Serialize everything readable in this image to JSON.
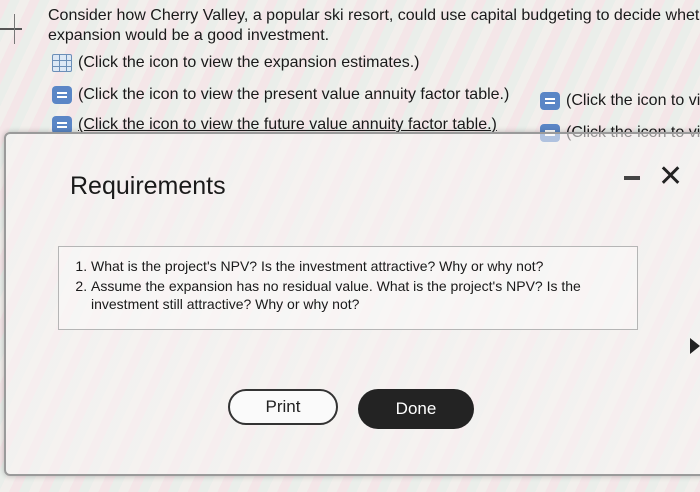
{
  "question": {
    "line1": "Consider how Cherry Valley, a popular ski resort, could use capital budgeting to decide whethe",
    "line2": "expansion would be a good investment."
  },
  "links": {
    "expansion": "(Click the icon to view the expansion estimates.)",
    "pv_annuity": "(Click the icon to view the present value annuity factor table.)",
    "fv_annuity": "(Click the icon to view the future value annuity factor table.)",
    "right_1": "(Click the icon to vie",
    "right_2": "(Click the icon to vie"
  },
  "dialog": {
    "title": "Requirements",
    "minimize_glyph": "",
    "close_glyph": "✕",
    "requirements": [
      "What is the project's NPV? Is the investment attractive? Why or why not?",
      "Assume the expansion has no residual value. What is the project's NPV? Is the investment still attractive? Why or why not?"
    ],
    "print_label": "Print",
    "done_label": "Done"
  }
}
